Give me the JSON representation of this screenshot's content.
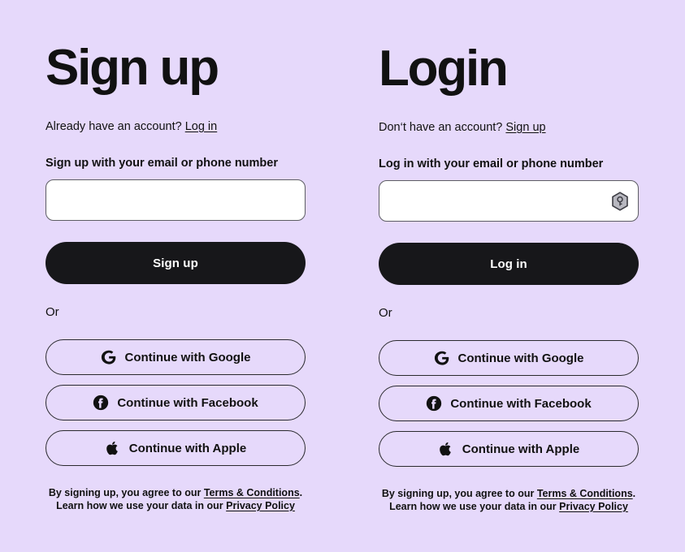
{
  "theme": {
    "background": "#e6d9fb",
    "text": "#111111",
    "primary_button_bg": "#17171a",
    "primary_button_text": "#ffffff",
    "input_bg": "#ffffff",
    "border": "#2a2a2e"
  },
  "signup_panel": {
    "heading": "Sign up",
    "switch_prompt": "Already have an account?",
    "switch_link": "Log in",
    "field_label": "Sign up with your email or phone number",
    "input_value": "",
    "input_placeholder": "",
    "primary_button": "Sign up",
    "or_label": "Or",
    "social_buttons": [
      {
        "icon": "google-icon",
        "label": "Continue with Google"
      },
      {
        "icon": "facebook-icon",
        "label": "Continue with Facebook"
      },
      {
        "icon": "apple-icon",
        "label": "Continue with Apple"
      }
    ],
    "legal": {
      "part1": "By signing up, you agree to our ",
      "terms_link": "Terms & Conditions",
      "part2": ". Learn how we use your data in our ",
      "privacy_link": "Privacy Policy"
    }
  },
  "login_panel": {
    "heading": "Login",
    "switch_prompt": "Don‘t have an account?",
    "switch_link": "Sign up",
    "field_label": "Log in with your email or phone number",
    "input_value": "",
    "input_placeholder": "",
    "autofill_icon": "password-key-badge-icon",
    "primary_button": "Log in",
    "or_label": "Or",
    "social_buttons": [
      {
        "icon": "google-icon",
        "label": "Continue with Google"
      },
      {
        "icon": "facebook-icon",
        "label": "Continue with Facebook"
      },
      {
        "icon": "apple-icon",
        "label": "Continue with Apple"
      }
    ],
    "legal": {
      "part1": "By signing up, you agree to our ",
      "terms_link": "Terms & Conditions",
      "part2": ". Learn how we use your data in our ",
      "privacy_link": "Privacy Policy"
    }
  }
}
